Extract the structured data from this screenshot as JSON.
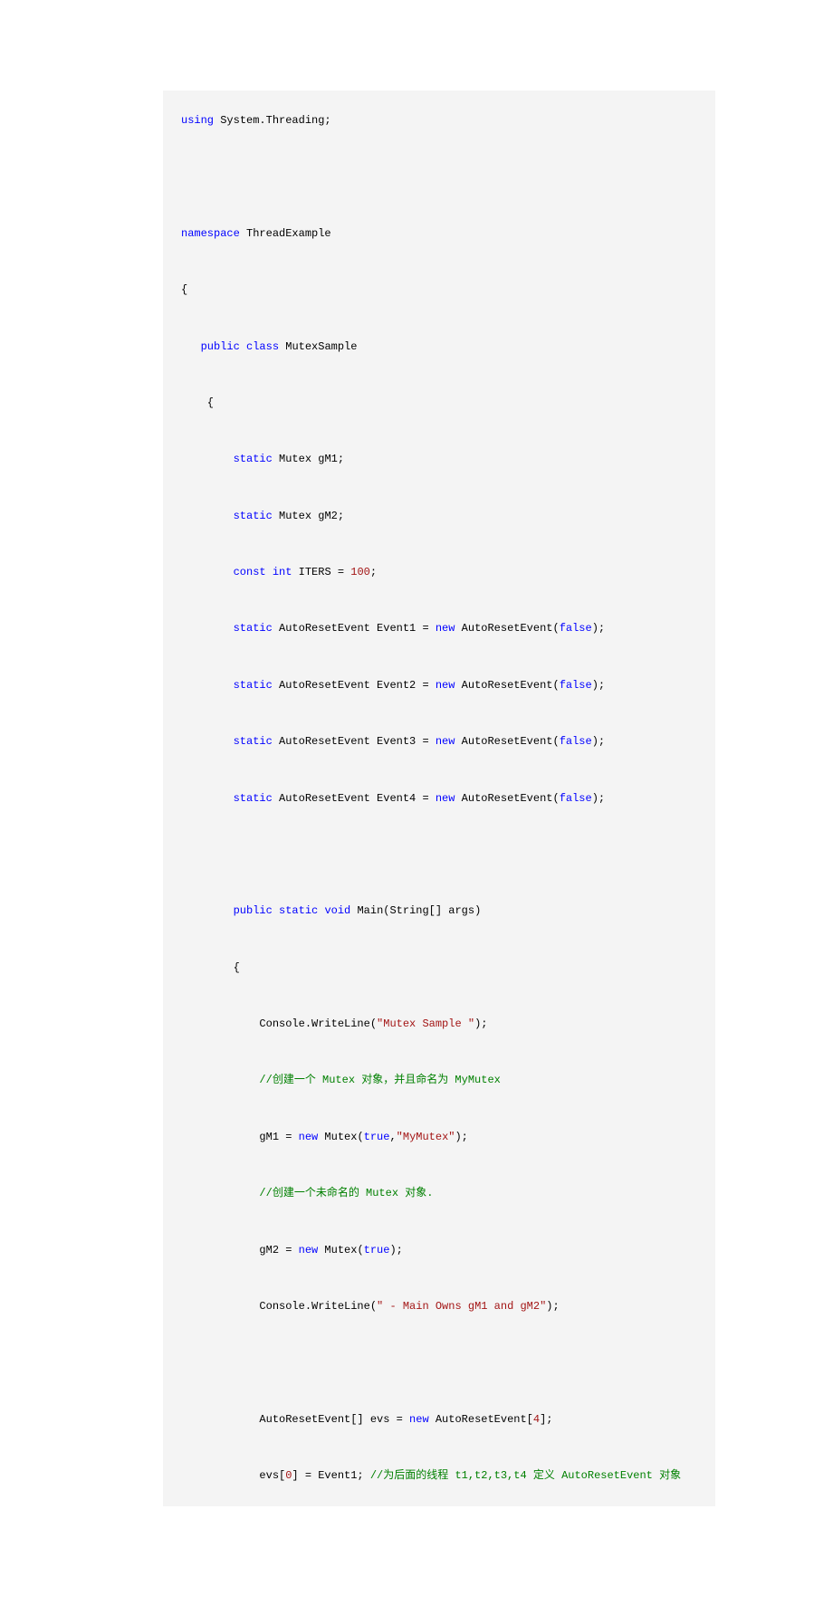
{
  "lines": [
    [
      {
        "t": "using",
        "c": "kw"
      },
      {
        "t": " System.Threading;"
      }
    ],
    [],
    [],
    [],
    [
      {
        "t": "namespace",
        "c": "kw"
      },
      {
        "t": " ThreadExample"
      }
    ],
    [],
    [
      {
        "t": "{"
      }
    ],
    [],
    [
      {
        "t": "   "
      },
      {
        "t": "public",
        "c": "kw"
      },
      {
        "t": " "
      },
      {
        "t": "class",
        "c": "kw"
      },
      {
        "t": " MutexSample"
      }
    ],
    [],
    [
      {
        "t": "    {"
      }
    ],
    [],
    [
      {
        "t": "        "
      },
      {
        "t": "static",
        "c": "kw"
      },
      {
        "t": " Mutex gM1;"
      }
    ],
    [],
    [
      {
        "t": "        "
      },
      {
        "t": "static",
        "c": "kw"
      },
      {
        "t": " Mutex gM2;"
      }
    ],
    [],
    [
      {
        "t": "        "
      },
      {
        "t": "const",
        "c": "kw"
      },
      {
        "t": " "
      },
      {
        "t": "int",
        "c": "kw"
      },
      {
        "t": " ITERS = "
      },
      {
        "t": "100",
        "c": "num"
      },
      {
        "t": ";"
      }
    ],
    [],
    [
      {
        "t": "        "
      },
      {
        "t": "static",
        "c": "kw"
      },
      {
        "t": " AutoResetEvent Event1 = "
      },
      {
        "t": "new",
        "c": "kw"
      },
      {
        "t": " AutoResetEvent("
      },
      {
        "t": "false",
        "c": "kw"
      },
      {
        "t": ");"
      }
    ],
    [],
    [
      {
        "t": "        "
      },
      {
        "t": "static",
        "c": "kw"
      },
      {
        "t": " AutoResetEvent Event2 = "
      },
      {
        "t": "new",
        "c": "kw"
      },
      {
        "t": " AutoResetEvent("
      },
      {
        "t": "false",
        "c": "kw"
      },
      {
        "t": ");"
      }
    ],
    [],
    [
      {
        "t": "        "
      },
      {
        "t": "static",
        "c": "kw"
      },
      {
        "t": " AutoResetEvent Event3 = "
      },
      {
        "t": "new",
        "c": "kw"
      },
      {
        "t": " AutoResetEvent("
      },
      {
        "t": "false",
        "c": "kw"
      },
      {
        "t": ");"
      }
    ],
    [],
    [
      {
        "t": "        "
      },
      {
        "t": "static",
        "c": "kw"
      },
      {
        "t": " AutoResetEvent Event4 = "
      },
      {
        "t": "new",
        "c": "kw"
      },
      {
        "t": " AutoResetEvent("
      },
      {
        "t": "false",
        "c": "kw"
      },
      {
        "t": ");"
      }
    ],
    [],
    [],
    [],
    [
      {
        "t": "        "
      },
      {
        "t": "public",
        "c": "kw"
      },
      {
        "t": " "
      },
      {
        "t": "static",
        "c": "kw"
      },
      {
        "t": " "
      },
      {
        "t": "void",
        "c": "kw"
      },
      {
        "t": " Main(String[] args)"
      }
    ],
    [],
    [
      {
        "t": "        {"
      }
    ],
    [],
    [
      {
        "t": "            Console.WriteLine("
      },
      {
        "t": "\"Mutex Sample \"",
        "c": "str"
      },
      {
        "t": ");"
      }
    ],
    [],
    [
      {
        "t": "            "
      },
      {
        "t": "//创建一个 Mutex 对象，并且命名为 MyMutex",
        "c": "cmt"
      }
    ],
    [],
    [
      {
        "t": "            gM1 = "
      },
      {
        "t": "new",
        "c": "kw"
      },
      {
        "t": " Mutex("
      },
      {
        "t": "true",
        "c": "kw"
      },
      {
        "t": ","
      },
      {
        "t": "\"MyMutex\"",
        "c": "str"
      },
      {
        "t": ");"
      }
    ],
    [],
    [
      {
        "t": "            "
      },
      {
        "t": "//创建一个未命名的 Mutex 对象.",
        "c": "cmt"
      }
    ],
    [],
    [
      {
        "t": "            gM2 = "
      },
      {
        "t": "new",
        "c": "kw"
      },
      {
        "t": " Mutex("
      },
      {
        "t": "true",
        "c": "kw"
      },
      {
        "t": ");"
      }
    ],
    [],
    [
      {
        "t": "            Console.WriteLine("
      },
      {
        "t": "\" - Main Owns gM1 and gM2\"",
        "c": "str"
      },
      {
        "t": ");"
      }
    ],
    [],
    [],
    [],
    [
      {
        "t": "            AutoResetEvent[] evs = "
      },
      {
        "t": "new",
        "c": "kw"
      },
      {
        "t": " AutoResetEvent["
      },
      {
        "t": "4",
        "c": "num"
      },
      {
        "t": "];"
      }
    ],
    [],
    [
      {
        "t": "            evs["
      },
      {
        "t": "0",
        "c": "num"
      },
      {
        "t": "] = Event1; "
      },
      {
        "t": "//为后面的线程 t1,t2,t3,t4 定义 AutoResetEvent 对象",
        "c": "cmt"
      }
    ]
  ]
}
